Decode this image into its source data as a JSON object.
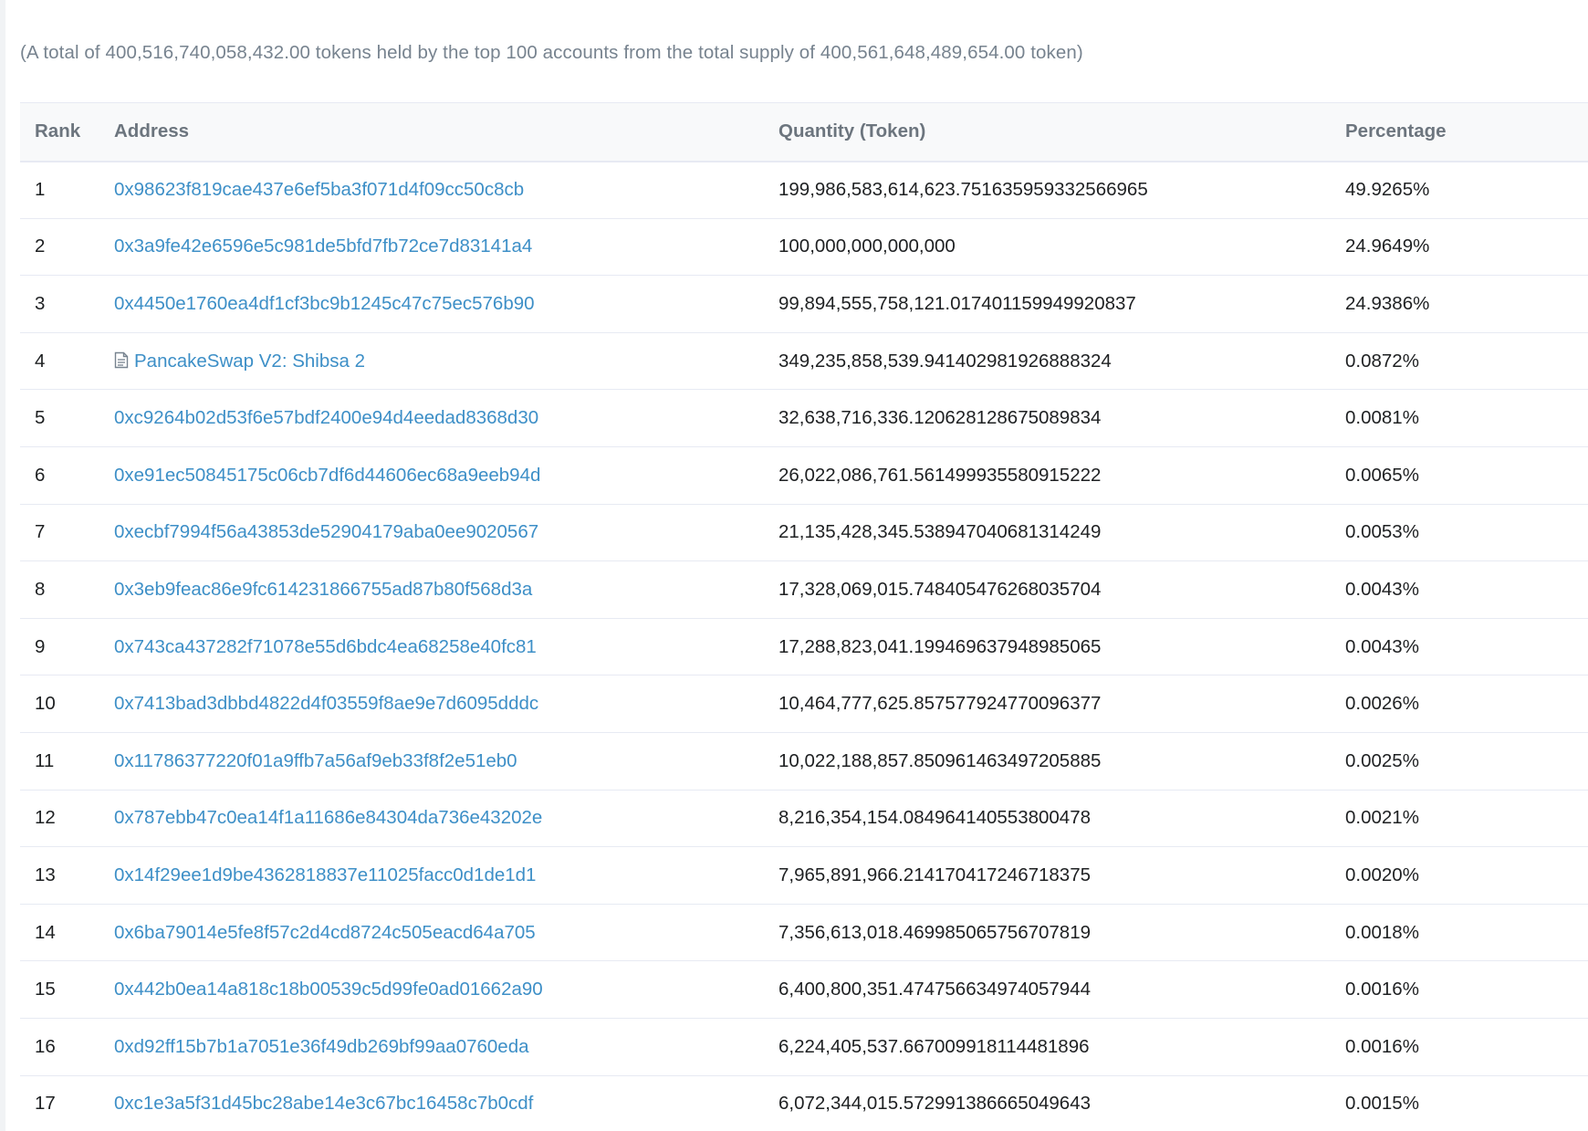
{
  "summary": {
    "text": "(A total of 400,516,740,058,432.00 tokens held by the top 100 accounts from the total supply of 400,561,648,489,654.00 token)"
  },
  "table": {
    "headers": {
      "rank": "Rank",
      "address": "Address",
      "quantity": "Quantity (Token)",
      "percentage": "Percentage"
    },
    "rows": [
      {
        "rank": "1",
        "address": "0x98623f819cae437e6ef5ba3f071d4f09cc50c8cb",
        "is_contract": false,
        "quantity": "199,986,583,614,623.751635959332566965",
        "percentage": "49.9265%"
      },
      {
        "rank": "2",
        "address": "0x3a9fe42e6596e5c981de5bfd7fb72ce7d83141a4",
        "is_contract": false,
        "quantity": "100,000,000,000,000",
        "percentage": "24.9649%"
      },
      {
        "rank": "3",
        "address": "0x4450e1760ea4df1cf3bc9b1245c47c75ec576b90",
        "is_contract": false,
        "quantity": "99,894,555,758,121.017401159949920837",
        "percentage": "24.9386%"
      },
      {
        "rank": "4",
        "address": "PancakeSwap V2: Shibsa 2",
        "is_contract": true,
        "icon": "contract-document-icon",
        "quantity": "349,235,858,539.941402981926888324",
        "percentage": "0.0872%"
      },
      {
        "rank": "5",
        "address": "0xc9264b02d53f6e57bdf2400e94d4eedad8368d30",
        "is_contract": false,
        "quantity": "32,638,716,336.120628128675089834",
        "percentage": "0.0081%"
      },
      {
        "rank": "6",
        "address": "0xe91ec50845175c06cb7df6d44606ec68a9eeb94d",
        "is_contract": false,
        "quantity": "26,022,086,761.561499935580915222",
        "percentage": "0.0065%"
      },
      {
        "rank": "7",
        "address": "0xecbf7994f56a43853de52904179aba0ee9020567",
        "is_contract": false,
        "quantity": "21,135,428,345.538947040681314249",
        "percentage": "0.0053%"
      },
      {
        "rank": "8",
        "address": "0x3eb9feac86e9fc614231866755ad87b80f568d3a",
        "is_contract": false,
        "quantity": "17,328,069,015.748405476268035704",
        "percentage": "0.0043%"
      },
      {
        "rank": "9",
        "address": "0x743ca437282f71078e55d6bdc4ea68258e40fc81",
        "is_contract": false,
        "quantity": "17,288,823,041.199469637948985065",
        "percentage": "0.0043%"
      },
      {
        "rank": "10",
        "address": "0x7413bad3dbbd4822d4f03559f8ae9e7d6095dddc",
        "is_contract": false,
        "quantity": "10,464,777,625.857577924770096377",
        "percentage": "0.0026%"
      },
      {
        "rank": "11",
        "address": "0x11786377220f01a9ffb7a56af9eb33f8f2e51eb0",
        "is_contract": false,
        "quantity": "10,022,188,857.850961463497205885",
        "percentage": "0.0025%"
      },
      {
        "rank": "12",
        "address": "0x787ebb47c0ea14f1a11686e84304da736e43202e",
        "is_contract": false,
        "quantity": "8,216,354,154.084964140553800478",
        "percentage": "0.0021%"
      },
      {
        "rank": "13",
        "address": "0x14f29ee1d9be4362818837e11025facc0d1de1d1",
        "is_contract": false,
        "quantity": "7,965,891,966.214170417246718375",
        "percentage": "0.0020%"
      },
      {
        "rank": "14",
        "address": "0x6ba79014e5fe8f57c2d4cd8724c505eacd64a705",
        "is_contract": false,
        "quantity": "7,356,613,018.469985065756707819",
        "percentage": "0.0018%"
      },
      {
        "rank": "15",
        "address": "0x442b0ea14a818c18b00539c5d99fe0ad01662a90",
        "is_contract": false,
        "quantity": "6,400,800,351.474756634974057944",
        "percentage": "0.0016%"
      },
      {
        "rank": "16",
        "address": "0xd92ff15b7b1a7051e36f49db269bf99aa0760eda",
        "is_contract": false,
        "quantity": "6,224,405,537.667009918114481896",
        "percentage": "0.0016%"
      },
      {
        "rank": "17",
        "address": "0xc1e3a5f31d45bc28abe14e3c67bc16458c7b0cdf",
        "is_contract": false,
        "quantity": "6,072,344,015.572991386665049643",
        "percentage": "0.0015%"
      }
    ]
  },
  "colors": {
    "link": "#3d8fc7",
    "muted_text": "#77838f",
    "header_text": "#6c757e",
    "body_text": "#1e2022",
    "border": "#e7eaf3"
  }
}
